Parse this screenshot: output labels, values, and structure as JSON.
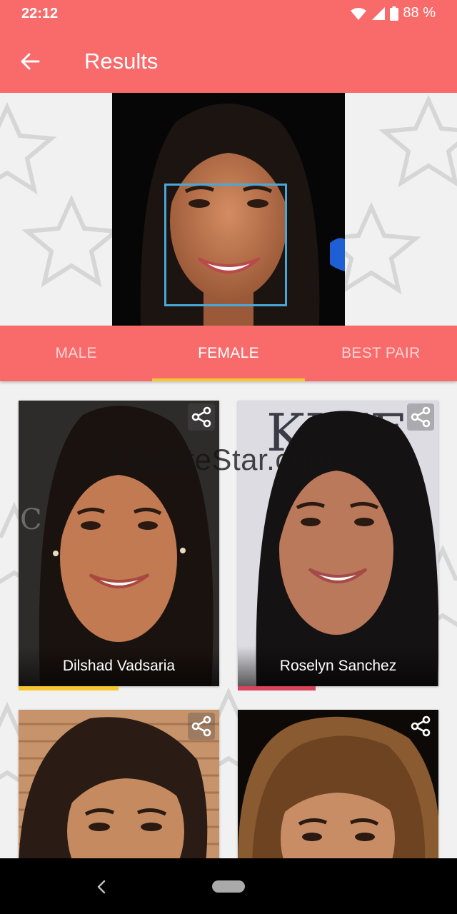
{
  "status_bar": {
    "time": "22:12",
    "battery": "88 %"
  },
  "app_bar": {
    "title": "Results"
  },
  "tabs": [
    {
      "label": "MALE",
      "active": false
    },
    {
      "label": "FEMALE",
      "active": true
    },
    {
      "label": "BEST PAIR",
      "active": false
    }
  ],
  "results": [
    {
      "name": "Dilshad Vadsaria",
      "match_bar_color": "#f7c631"
    },
    {
      "name": "Roselyn Sanchez",
      "match_bar_color": "#d9445a"
    },
    {
      "name": "",
      "match_bar_color": ""
    },
    {
      "name": "",
      "match_bar_color": ""
    }
  ],
  "watermark": "UpdateStar.com",
  "colors": {
    "accent": "#f96a6a",
    "tab_indicator": "#f7c631",
    "face_box": "#4aa8d8"
  }
}
